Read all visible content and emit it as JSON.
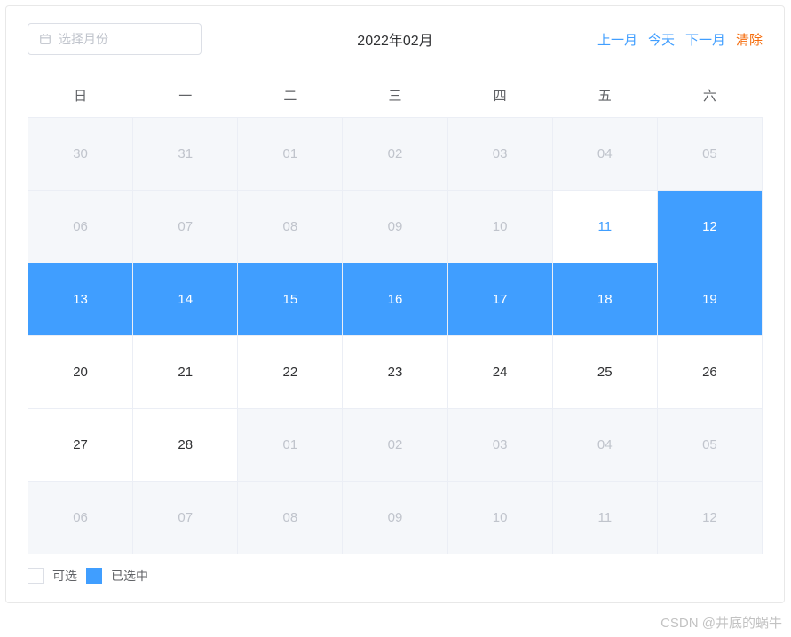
{
  "header": {
    "placeholder": "选择月份",
    "title": "2022年02月",
    "nav": {
      "prev": "上一月",
      "today": "今天",
      "next": "下一月",
      "clear": "清除"
    }
  },
  "weekdays": [
    "日",
    "一",
    "二",
    "三",
    "四",
    "五",
    "六"
  ],
  "weeks": [
    [
      {
        "d": "30",
        "state": "other"
      },
      {
        "d": "31",
        "state": "other"
      },
      {
        "d": "01",
        "state": "other"
      },
      {
        "d": "02",
        "state": "other"
      },
      {
        "d": "03",
        "state": "other"
      },
      {
        "d": "04",
        "state": "other"
      },
      {
        "d": "05",
        "state": "other"
      }
    ],
    [
      {
        "d": "06",
        "state": "other"
      },
      {
        "d": "07",
        "state": "other"
      },
      {
        "d": "08",
        "state": "other"
      },
      {
        "d": "09",
        "state": "other"
      },
      {
        "d": "10",
        "state": "other"
      },
      {
        "d": "11",
        "state": "today"
      },
      {
        "d": "12",
        "state": "selected"
      }
    ],
    [
      {
        "d": "13",
        "state": "selected"
      },
      {
        "d": "14",
        "state": "selected"
      },
      {
        "d": "15",
        "state": "selected"
      },
      {
        "d": "16",
        "state": "selected"
      },
      {
        "d": "17",
        "state": "selected"
      },
      {
        "d": "18",
        "state": "selected"
      },
      {
        "d": "19",
        "state": "selected"
      }
    ],
    [
      {
        "d": "20",
        "state": "current"
      },
      {
        "d": "21",
        "state": "current"
      },
      {
        "d": "22",
        "state": "current"
      },
      {
        "d": "23",
        "state": "current"
      },
      {
        "d": "24",
        "state": "current"
      },
      {
        "d": "25",
        "state": "current"
      },
      {
        "d": "26",
        "state": "current"
      }
    ],
    [
      {
        "d": "27",
        "state": "current"
      },
      {
        "d": "28",
        "state": "current"
      },
      {
        "d": "01",
        "state": "other"
      },
      {
        "d": "02",
        "state": "other"
      },
      {
        "d": "03",
        "state": "other"
      },
      {
        "d": "04",
        "state": "other"
      },
      {
        "d": "05",
        "state": "other"
      }
    ],
    [
      {
        "d": "06",
        "state": "other"
      },
      {
        "d": "07",
        "state": "other"
      },
      {
        "d": "08",
        "state": "other"
      },
      {
        "d": "09",
        "state": "other"
      },
      {
        "d": "10",
        "state": "other"
      },
      {
        "d": "11",
        "state": "other"
      },
      {
        "d": "12",
        "state": "other"
      }
    ]
  ],
  "legend": {
    "available": "可选",
    "selected": "已选中"
  },
  "watermark": "CSDN @井底的蜗牛"
}
